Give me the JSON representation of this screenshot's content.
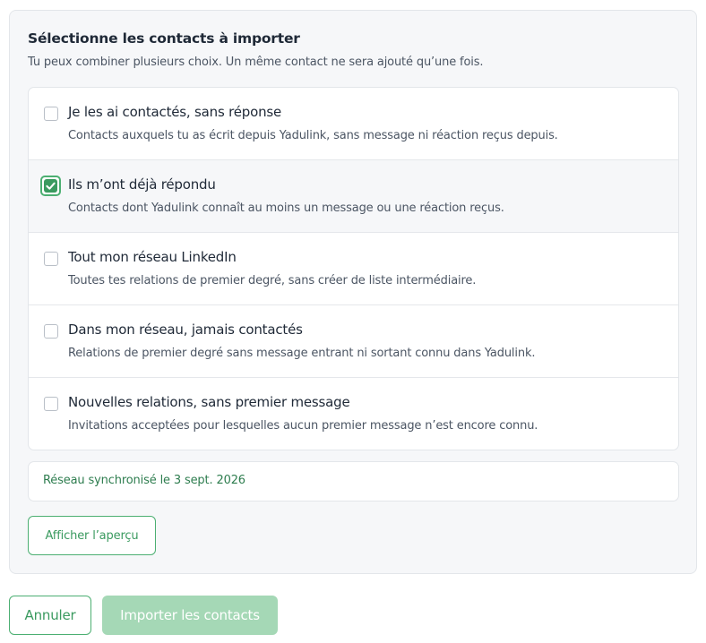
{
  "panel": {
    "title": "Sélectionne les contacts à importer",
    "subtitle": "Tu peux combiner plusieurs choix. Un même contact ne sera ajouté qu’une fois."
  },
  "options": [
    {
      "title": "Je les ai contactés, sans réponse",
      "description": "Contacts auxquels tu as écrit depuis Yadulink, sans message ni réaction reçus depuis.",
      "checked": false
    },
    {
      "title": "Ils m’ont déjà répondu",
      "description": "Contacts dont Yadulink connaît au moins un message ou une réaction reçus.",
      "checked": true
    },
    {
      "title": "Tout mon réseau LinkedIn",
      "description": "Toutes tes relations de premier degré, sans créer de liste intermédiaire.",
      "checked": false
    },
    {
      "title": "Dans mon réseau, jamais contactés",
      "description": "Relations de premier degré sans message entrant ni sortant connu dans Yadulink.",
      "checked": false
    },
    {
      "title": "Nouvelles relations, sans premier message",
      "description": "Invitations acceptées pour lesquelles aucun premier message n’est encore connu.",
      "checked": false
    }
  ],
  "sync": {
    "text": "Réseau synchronisé le 3 sept. 2026"
  },
  "buttons": {
    "preview": "Afficher l’aperçu",
    "cancel": "Annuler",
    "import": "Importer les contacts",
    "import_disabled": true
  },
  "colors": {
    "accent": "#3a9a5f",
    "accent_border": "#4caf72",
    "disabled_button": "#a5d8b6",
    "sync_text": "#2e7d4f"
  },
  "icons": {
    "checkbox_checked": "check-icon"
  }
}
